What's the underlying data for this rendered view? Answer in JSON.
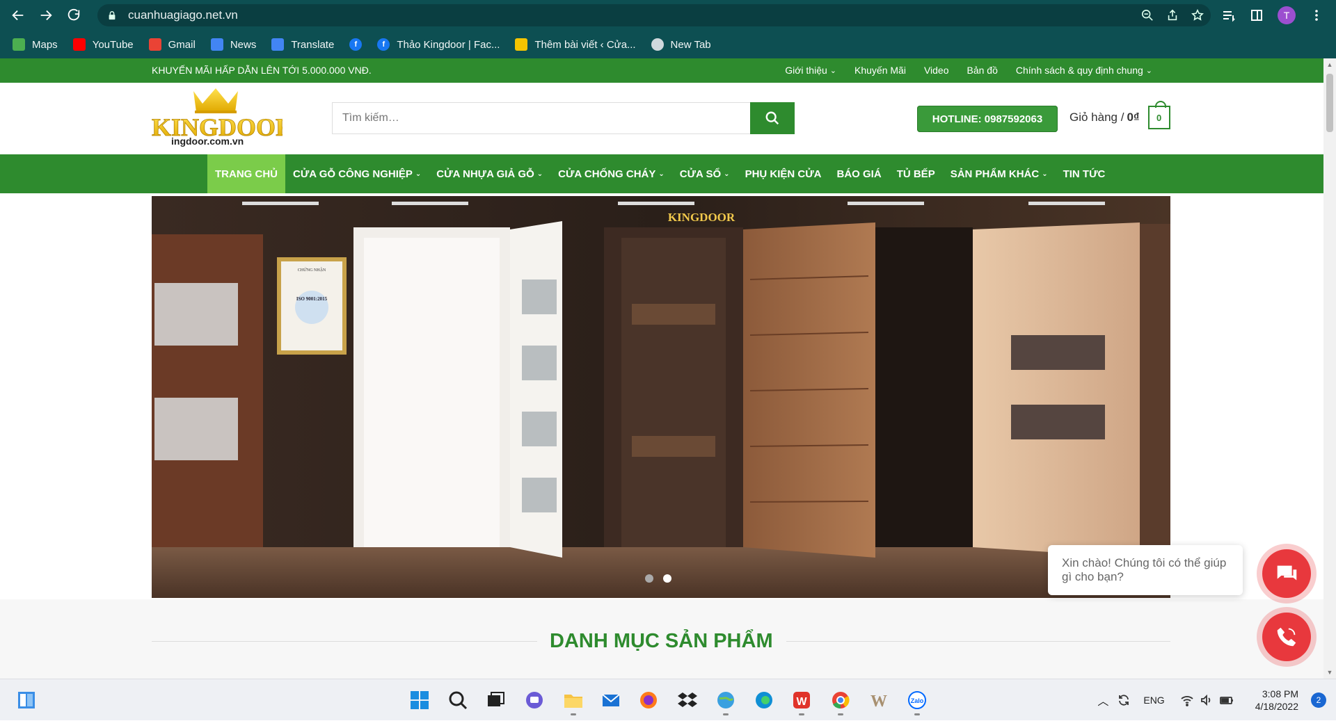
{
  "browser": {
    "url": "cuanhuagiago.net.vn",
    "bookmarks": [
      {
        "label": "Maps",
        "icon": "maps-icon",
        "color": "#4caf50"
      },
      {
        "label": "YouTube",
        "icon": "youtube-icon",
        "color": "#ff0000"
      },
      {
        "label": "Gmail",
        "icon": "gmail-icon",
        "color": "#ea4335"
      },
      {
        "label": "News",
        "icon": "news-icon",
        "color": "#4285f4"
      },
      {
        "label": "Translate",
        "icon": "translate-icon",
        "color": "#4285f4"
      },
      {
        "label": "",
        "icon": "facebook-icon",
        "color": "#1877f2"
      },
      {
        "label": "Thảo Kingdoor | Fac...",
        "icon": "facebook-icon",
        "color": "#1877f2"
      },
      {
        "label": "Thêm bài viết ‹ Cửa...",
        "icon": "crown-icon",
        "color": "#f5c400"
      },
      {
        "label": "New Tab",
        "icon": "globe-icon",
        "color": "#cfd8dc"
      }
    ],
    "profile_initial": "T"
  },
  "topbar": {
    "promo": "KHUYẾN MÃI HẤP DẪN LÊN TỚI 5.000.000 VNĐ.",
    "links": [
      {
        "label": "Giới thiệu",
        "has_dropdown": true
      },
      {
        "label": "Khuyến Mãi",
        "has_dropdown": false
      },
      {
        "label": "Video",
        "has_dropdown": false
      },
      {
        "label": "Bản đồ",
        "has_dropdown": false
      },
      {
        "label": "Chính sách & quy định chung",
        "has_dropdown": true
      }
    ]
  },
  "header": {
    "logo_text": "KINGDOOR",
    "logo_sub": "ingdoor.com.vn",
    "search_placeholder": "Tìm kiếm…",
    "hotline": "HOTLINE: 0987592063",
    "cart_label": "Giỏ hàng /",
    "cart_total": "0₫",
    "cart_count": "0"
  },
  "nav": [
    {
      "label": "TRANG CHỦ",
      "active": true,
      "dropdown": false
    },
    {
      "label": "CỬA GỖ CÔNG NGHIỆP",
      "active": false,
      "dropdown": true
    },
    {
      "label": "CỬA NHỰA GIẢ GỖ",
      "active": false,
      "dropdown": true
    },
    {
      "label": "CỬA CHỐNG CHÁY",
      "active": false,
      "dropdown": true
    },
    {
      "label": "CỬA SỔ",
      "active": false,
      "dropdown": true
    },
    {
      "label": "PHỤ KIỆN CỬA",
      "active": false,
      "dropdown": false
    },
    {
      "label": "BÁO GIÁ",
      "active": false,
      "dropdown": false
    },
    {
      "label": "TỦ BẾP",
      "active": false,
      "dropdown": false
    },
    {
      "label": "SẢN PHẨM KHÁC",
      "active": false,
      "dropdown": true
    },
    {
      "label": "TIN TỨC",
      "active": false,
      "dropdown": false
    }
  ],
  "banner": {
    "brand_text": "KINGDOOR",
    "certificate_title": "CHỨNG NHẬN",
    "certificate_iso": "ISO 9001:2015",
    "slide_count": 2,
    "active_slide": 2
  },
  "section": {
    "title": "DANH MỤC SẢN PHẨM"
  },
  "chat": {
    "message": "Xin chào! Chúng tôi có thể giúp gì cho bạn?"
  },
  "taskbar": {
    "lang": "ENG",
    "time": "3:08 PM",
    "date": "4/18/2022",
    "notifications": "2"
  },
  "colors": {
    "brand_green": "#2e8b2e",
    "active_nav": "#7bcc4a",
    "chat_red": "#e8383d",
    "chrome_bg": "#0d4f52"
  }
}
